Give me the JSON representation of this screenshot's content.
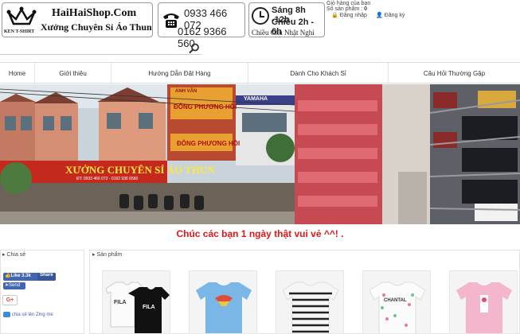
{
  "header": {
    "logo": {
      "title": "HaiHaiShop.Com",
      "tagline": "Xưởng Chuyên Sỉ Áo Thun",
      "sub": "KEN T-SHIRT"
    },
    "phones": [
      "0933 466 072",
      "0162 9366 560"
    ],
    "hours": {
      "line1": "Sáng 8h -12h",
      "line2": "Chiều 2h - 6h",
      "line3": "Chiều Chủ Nhật Nghỉ"
    },
    "cart": {
      "label": "Giỏ hàng của bạn",
      "count_label": "Số sản phẩm : ",
      "count": "0"
    },
    "login_label": "Đăng nhập",
    "register_label": "Đăng ký"
  },
  "nav": {
    "items": [
      {
        "label": "Home"
      },
      {
        "label": "Giới thiệu"
      },
      {
        "label": "Hướng Dẫn Đặt Hàng"
      },
      {
        "label": "Dành Cho Khách Sỉ"
      },
      {
        "label": "Câu Hỏi Thường Gặp"
      }
    ]
  },
  "banner": {
    "sign_main": "XƯỞNG CHUYÊN SỈ ÁO THUN",
    "sign_phone": "ĐT: 0933 466 072 - 0162 936 6560",
    "sign_top1": "ANH VÂN",
    "sign_top2": "ĐÔNG PHƯƠNG HỒI",
    "sign_yamaha": "YAMAHA"
  },
  "welcome": "Chúc các bạn 1 ngày thật vui vẻ ^^! .",
  "share": {
    "title": "Chia sẻ",
    "fb_like": "Like 3.3k",
    "fb_share": "Share",
    "send": "Send",
    "gplus": "G+",
    "zing": "chia sẻ lên Zing me"
  },
  "products": {
    "title": "Sản phẩm",
    "items": [
      {
        "print": "FILA"
      },
      {
        "print": ""
      },
      {
        "print": ""
      },
      {
        "print": "CHANTAL"
      },
      {
        "print": ""
      }
    ]
  },
  "colors": {
    "accent_red": "#e01818",
    "fb_blue": "#4267b2"
  }
}
